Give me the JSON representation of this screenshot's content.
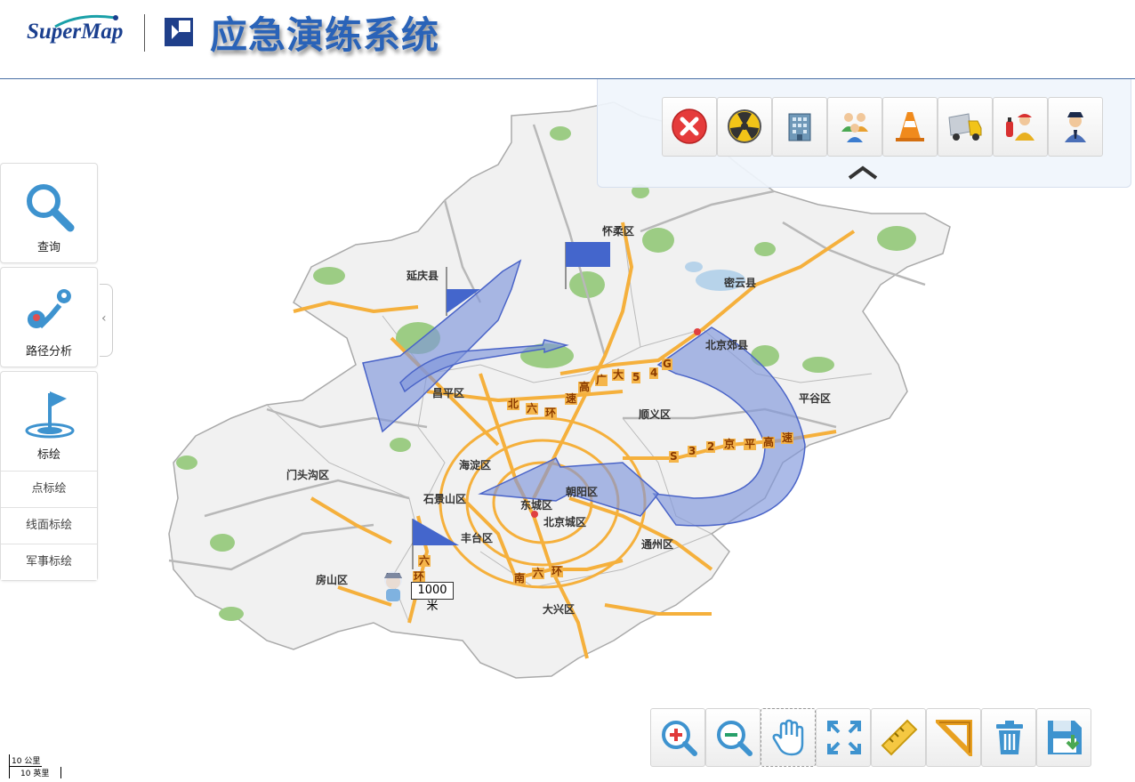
{
  "header": {
    "logo_text": "SuperMap",
    "app_title": "应急演练系统"
  },
  "left_panel": {
    "query_label": "查询",
    "route_label": "路径分析",
    "plot_label": "标绘",
    "plot_items": [
      "点标绘",
      "线面标绘",
      "军事标绘"
    ]
  },
  "event_toolbar": {
    "buttons": [
      "close-icon",
      "radiation-icon",
      "building-icon",
      "crowd-icon",
      "traffic-cone-icon",
      "truck-icon",
      "firefighter-icon",
      "police-icon"
    ]
  },
  "bottom_toolbar": {
    "buttons": [
      "zoom-in-icon",
      "zoom-out-icon",
      "pan-hand-icon",
      "full-extent-icon",
      "ruler-icon",
      "area-measure-icon",
      "delete-icon",
      "save-icon"
    ]
  },
  "map": {
    "districts": {
      "huairou": "怀柔区",
      "yanqing": "延庆县",
      "miyun": "密云县",
      "beijingbu": "北京郊县",
      "pinggu": "平谷区",
      "changping": "昌平区",
      "shunyi": "顺义区",
      "haidian": "海淀区",
      "mentougou": "门头沟区",
      "shijingshan": "石景山区",
      "dongcheng": "东城区",
      "chaoyang": "朝阳区",
      "xicheng": "北京城区",
      "fengtai": "丰台区",
      "tongzhou": "通州区",
      "fangshan": "房山区",
      "daxing": "大兴区"
    },
    "roads": {
      "north_ring": [
        "北",
        "六",
        "环"
      ],
      "gaoguang": [
        "高",
        "广",
        "大",
        "5",
        "4",
        "G"
      ],
      "s32": [
        "S",
        "3",
        "2",
        "京",
        "平",
        "高",
        "速"
      ],
      "su": "速",
      "south_ring": [
        "南",
        "六",
        "环"
      ],
      "west_ring": [
        "六",
        "环"
      ]
    },
    "scale_text": "1000米",
    "scale_km": "10 公里",
    "scale_mi": "10 英里"
  },
  "colors": {
    "arrow_fill": "#7f97dc",
    "flag_blue": "#4466cc",
    "road": "#f5b03c",
    "title_blue": "#2a63b8"
  }
}
